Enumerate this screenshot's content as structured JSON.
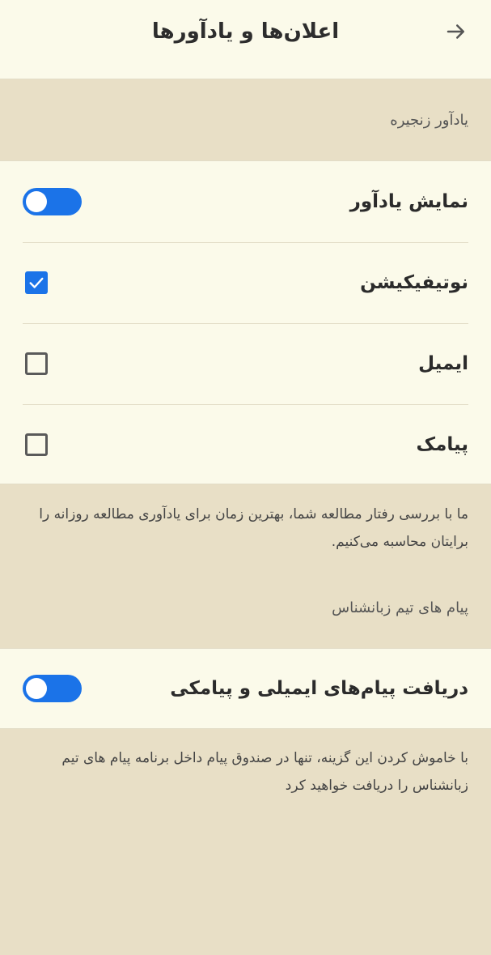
{
  "header": {
    "title": "اعلان‌ها و یادآورها",
    "back_icon": "arrow-right-icon"
  },
  "chain_section": {
    "heading": "یادآور زنجیره",
    "rows": [
      {
        "label": "نمایش یادآور",
        "control": "toggle",
        "state": "on"
      },
      {
        "label": "نوتیفیکیشن",
        "control": "checkbox",
        "checked": true
      },
      {
        "label": "ایمیل",
        "control": "checkbox",
        "checked": false
      },
      {
        "label": "پیامک",
        "control": "checkbox",
        "checked": false
      }
    ],
    "description": "ما با بررسی رفتار مطالعه شما، بهترین زمان برای یادآوری مطالعه روزانه را برایتان محاسبه می‌کنیم."
  },
  "team_section": {
    "heading": "پیام های تیم زبانشناس",
    "rows": [
      {
        "label": "دریافت پیام‌های ایمیلی و پیامکی",
        "control": "toggle",
        "state": "on"
      }
    ],
    "description": "با خاموش کردن این گزینه، تنها در صندوق پیام داخل برنامه پیام های تیم زبانشناس را دریافت خواهید کرد"
  },
  "colors": {
    "accent": "#1b73e8",
    "panel_bg": "#fbfaea",
    "page_bg": "#e8dfc6"
  }
}
